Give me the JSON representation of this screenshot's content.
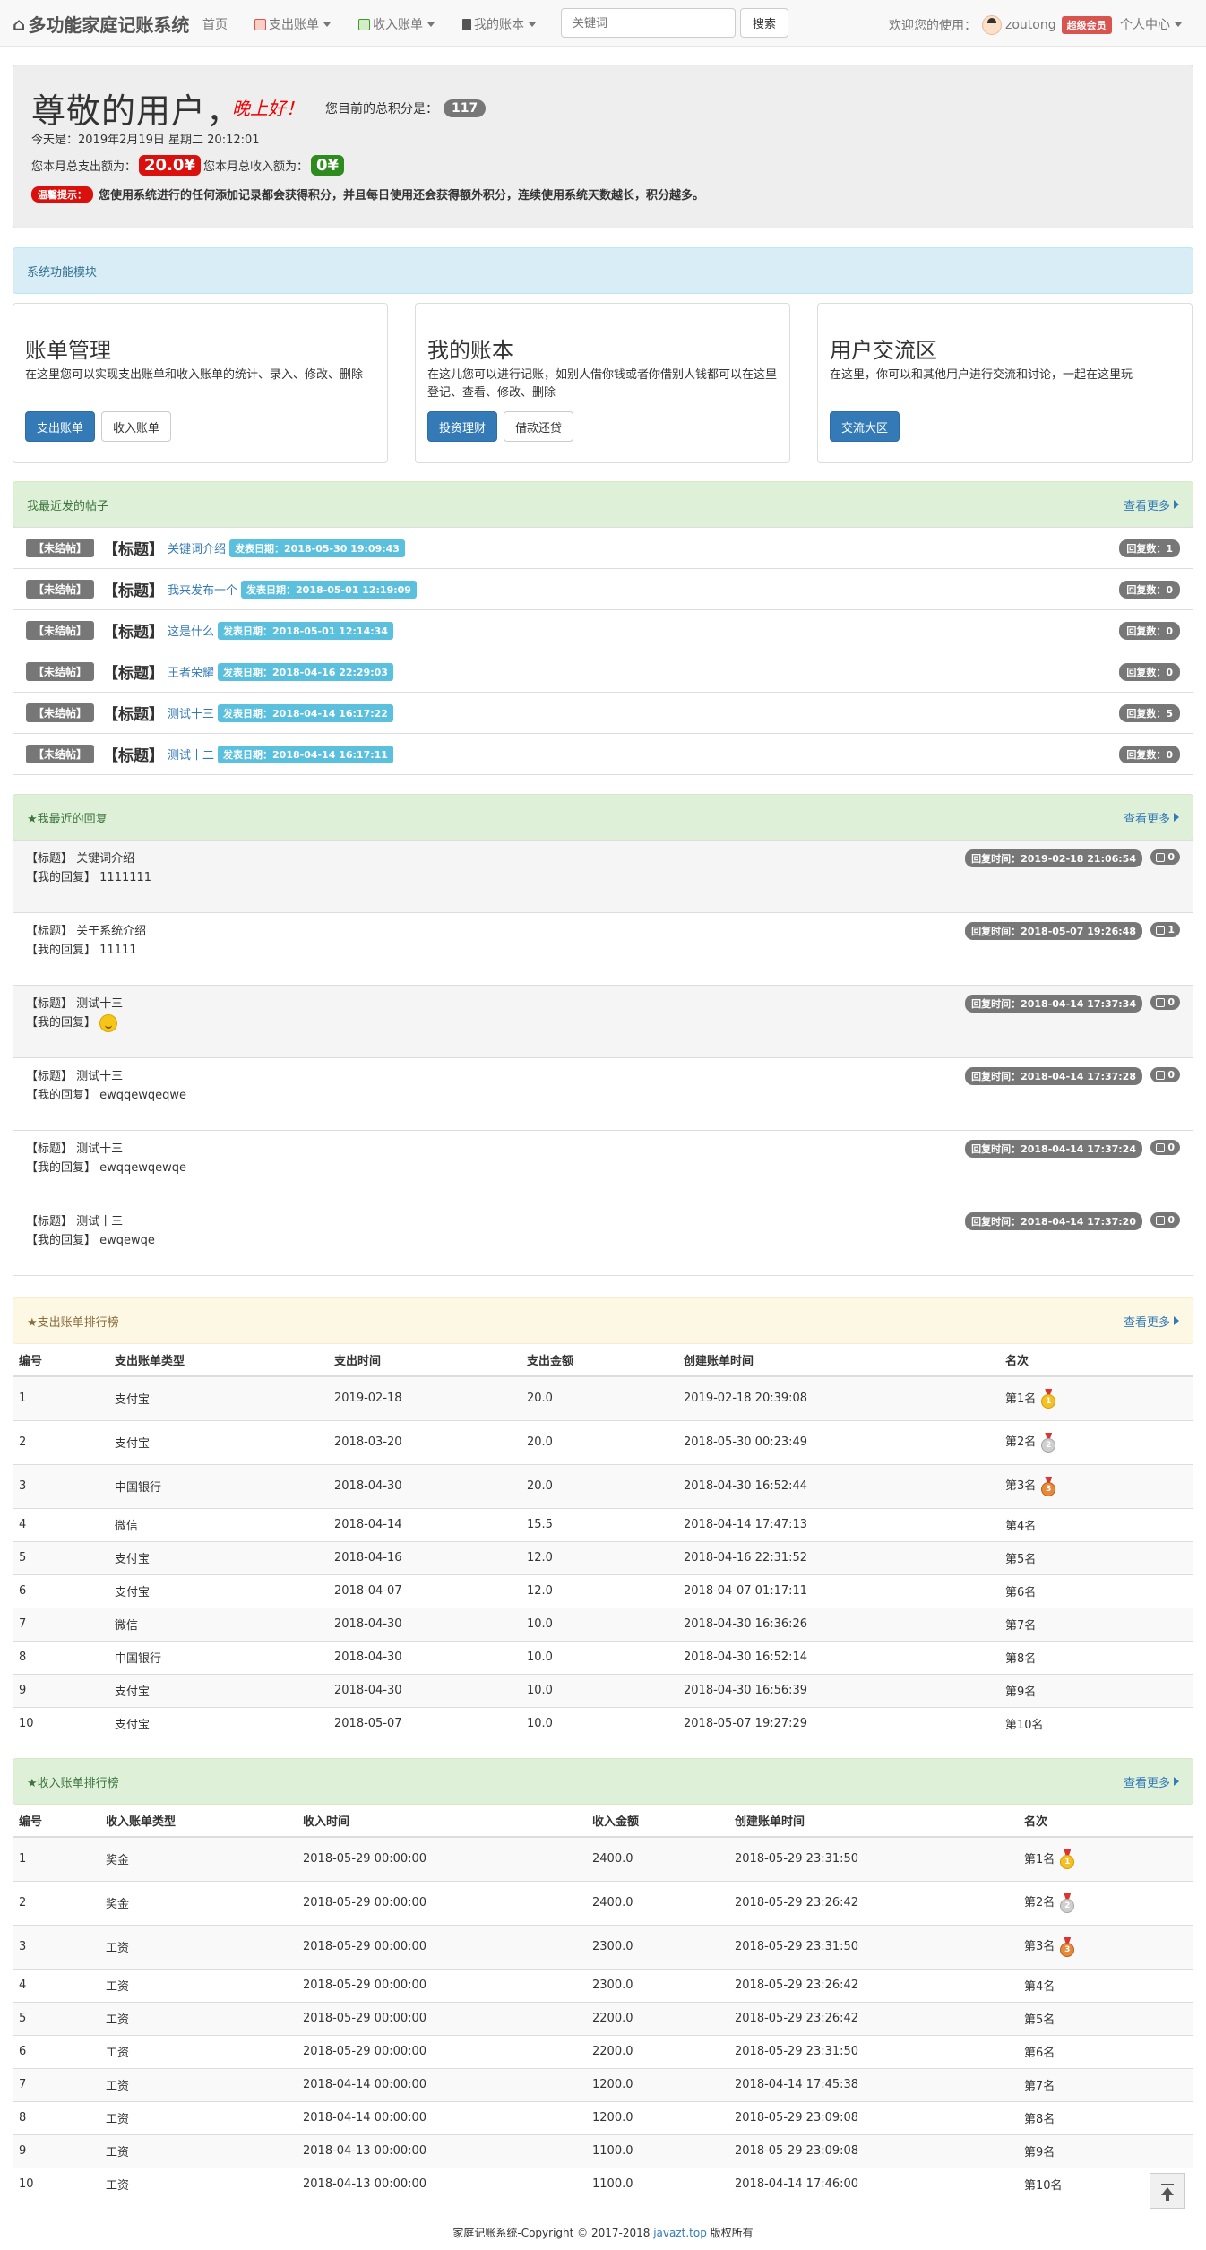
{
  "nav": {
    "brand": "多功能家庭记账系统",
    "home": "首页",
    "expense": "支出账单",
    "income": "收入账单",
    "mybook": "我的账本",
    "search_placeholder": "关键词",
    "search_btn": "搜索",
    "welcome": "欢迎您的使用：",
    "username": "zoutong",
    "vip": "超级会员",
    "user_center": "个人中心"
  },
  "jumbo": {
    "title": "尊敬的用户，",
    "greeting": "晚上好！",
    "score_label": "您目前的总积分是：",
    "score": "117",
    "date": "今天是：2019年2月19日 星期二 20:12:01",
    "expense_label": "您本月总支出额为：",
    "expense_value": "20.0¥",
    "income_label": "您本月总收入额为：",
    "income_value": "0¥",
    "tip_label": "温馨提示：",
    "tip_text": "您使用系统进行的任何添加记录都会获得积分，并且每日使用还会获得额外积分，连续使用系统天数越长，积分越多。"
  },
  "module_header": "系统功能模块",
  "cards": [
    {
      "title": "账单管理",
      "desc": "在这里您可以实现支出账单和收入账单的统计、录入、修改、删除",
      "btn1": "支出账单",
      "btn2": "收入账单"
    },
    {
      "title": "我的账本",
      "desc": "在这儿您可以进行记账，如别人借你钱或者你借别人钱都可以在这里登记、查看、修改、删除",
      "btn1": "投资理财",
      "btn2": "借款还贷"
    },
    {
      "title": "用户交流区",
      "desc": "在这里，你可以和其他用户进行交流和讨论，一起在这里玩",
      "btn1": "交流大区"
    }
  ],
  "posts": {
    "header": "我最近发的帖子",
    "more": "查看更多",
    "status": "【未结帖】",
    "title_prefix": "【标题】",
    "items": [
      {
        "title": "关键词介绍",
        "date": "发表日期：2018-05-30 19:09:43",
        "replies": "回复数：1"
      },
      {
        "title": "我来发布一个",
        "date": "发表日期：2018-05-01 12:19:09",
        "replies": "回复数：0"
      },
      {
        "title": "这是什么",
        "date": "发表日期：2018-05-01 12:14:34",
        "replies": "回复数：0"
      },
      {
        "title": "王者荣耀",
        "date": "发表日期：2018-04-16 22:29:03",
        "replies": "回复数：0"
      },
      {
        "title": "测试十三",
        "date": "发表日期：2018-04-14 16:17:22",
        "replies": "回复数：5"
      },
      {
        "title": "测试十二",
        "date": "发表日期：2018-04-14 16:17:11",
        "replies": "回复数：0"
      }
    ]
  },
  "replies": {
    "header": "★我最近的回复",
    "more": "查看更多",
    "title_prefix": "【标题】",
    "reply_prefix": "【我的回复】",
    "items": [
      {
        "title": "关键词介绍",
        "reply": "1111111",
        "time": "回复时间：2019-02-18 21:06:54",
        "likes": "0"
      },
      {
        "title": "关于系统介绍",
        "reply": "11111",
        "time": "回复时间：2018-05-07 19:26:48",
        "likes": "1"
      },
      {
        "title": "测试十三",
        "reply": "",
        "time": "回复时间：2018-04-14 17:37:34",
        "likes": "0"
      },
      {
        "title": "测试十三",
        "reply": "ewqqewqeqwe",
        "time": "回复时间：2018-04-14 17:37:28",
        "likes": "0"
      },
      {
        "title": "测试十三",
        "reply": "ewqqewqewqe",
        "time": "回复时间：2018-04-14 17:37:24",
        "likes": "0"
      },
      {
        "title": "测试十三",
        "reply": "ewqewqe",
        "time": "回复时间：2018-04-14 17:37:20",
        "likes": "0"
      }
    ]
  },
  "expense_rank": {
    "header": "★支出账单排行榜",
    "more": "查看更多",
    "columns": [
      "编号",
      "支出账单类型",
      "支出时间",
      "支出金额",
      "创建账单时间",
      "名次"
    ],
    "rows": [
      [
        "1",
        "支付宝",
        "2019-02-18",
        "20.0",
        "2019-02-18 20:39:08",
        "第1名"
      ],
      [
        "2",
        "支付宝",
        "2018-03-20",
        "20.0",
        "2018-05-30 00:23:49",
        "第2名"
      ],
      [
        "3",
        "中国银行",
        "2018-04-30",
        "20.0",
        "2018-04-30 16:52:44",
        "第3名"
      ],
      [
        "4",
        "微信",
        "2018-04-14",
        "15.5",
        "2018-04-14 17:47:13",
        "第4名"
      ],
      [
        "5",
        "支付宝",
        "2018-04-16",
        "12.0",
        "2018-04-16 22:31:52",
        "第5名"
      ],
      [
        "6",
        "支付宝",
        "2018-04-07",
        "12.0",
        "2018-04-07 01:17:11",
        "第6名"
      ],
      [
        "7",
        "微信",
        "2018-04-30",
        "10.0",
        "2018-04-30 16:36:26",
        "第7名"
      ],
      [
        "8",
        "中国银行",
        "2018-04-30",
        "10.0",
        "2018-04-30 16:52:14",
        "第8名"
      ],
      [
        "9",
        "支付宝",
        "2018-04-30",
        "10.0",
        "2018-04-30 16:56:39",
        "第9名"
      ],
      [
        "10",
        "支付宝",
        "2018-05-07",
        "10.0",
        "2018-05-07 19:27:29",
        "第10名"
      ]
    ]
  },
  "income_rank": {
    "header": "★收入账单排行榜",
    "more": "查看更多",
    "columns": [
      "编号",
      "收入账单类型",
      "收入时间",
      "收入金额",
      "创建账单时间",
      "名次"
    ],
    "rows": [
      [
        "1",
        "奖金",
        "2018-05-29 00:00:00",
        "2400.0",
        "2018-05-29 23:31:50",
        "第1名"
      ],
      [
        "2",
        "奖金",
        "2018-05-29 00:00:00",
        "2400.0",
        "2018-05-29 23:26:42",
        "第2名"
      ],
      [
        "3",
        "工资",
        "2018-05-29 00:00:00",
        "2300.0",
        "2018-05-29 23:31:50",
        "第3名"
      ],
      [
        "4",
        "工资",
        "2018-05-29 00:00:00",
        "2300.0",
        "2018-05-29 23:26:42",
        "第4名"
      ],
      [
        "5",
        "工资",
        "2018-05-29 00:00:00",
        "2200.0",
        "2018-05-29 23:26:42",
        "第5名"
      ],
      [
        "6",
        "工资",
        "2018-05-29 00:00:00",
        "2200.0",
        "2018-05-29 23:31:50",
        "第6名"
      ],
      [
        "7",
        "工资",
        "2018-04-14 00:00:00",
        "1200.0",
        "2018-04-14 17:45:38",
        "第7名"
      ],
      [
        "8",
        "工资",
        "2018-04-14 00:00:00",
        "1200.0",
        "2018-05-29 23:09:08",
        "第8名"
      ],
      [
        "9",
        "工资",
        "2018-04-13 00:00:00",
        "1100.0",
        "2018-05-29 23:09:08",
        "第9名"
      ],
      [
        "10",
        "工资",
        "2018-04-13 00:00:00",
        "1100.0",
        "2018-04-14 17:46:00",
        "第10名"
      ]
    ]
  },
  "medals": [
    "1",
    "2",
    "3"
  ],
  "footer": {
    "prefix": "家庭记账系统-Copyright © 2017-2018 ",
    "link": "javazt.top",
    "suffix": " 版权所有"
  }
}
